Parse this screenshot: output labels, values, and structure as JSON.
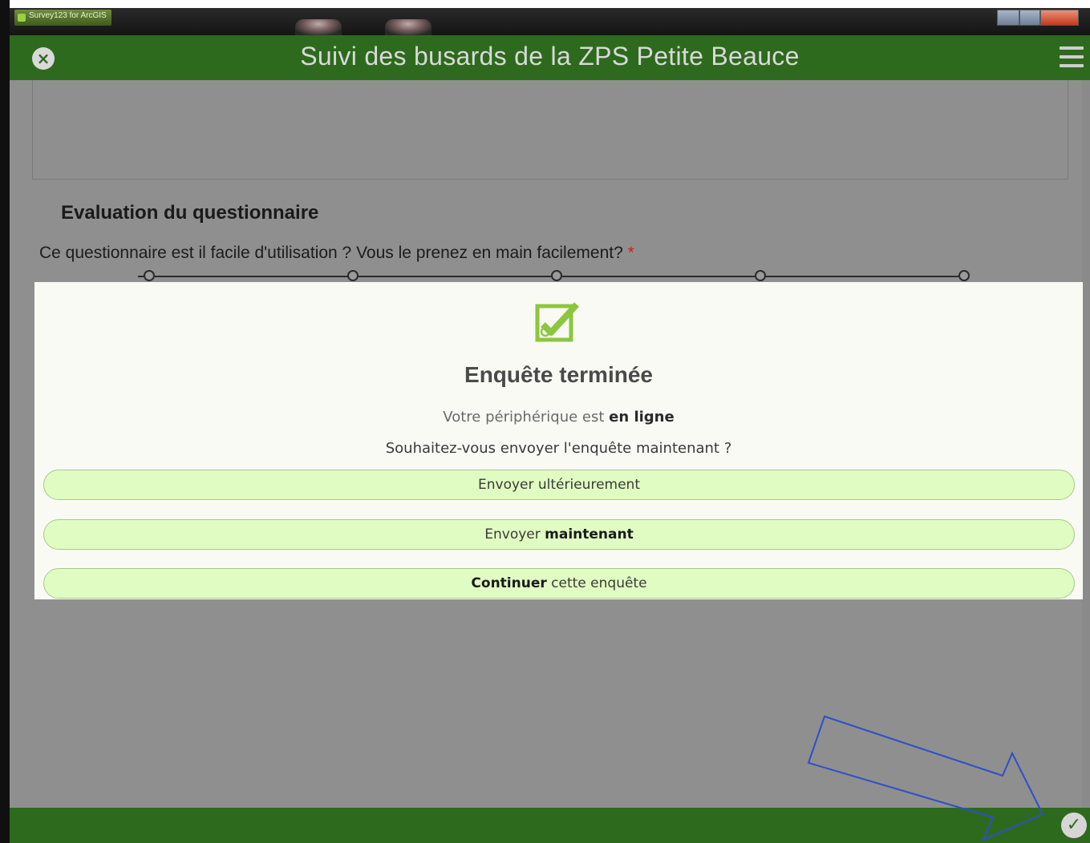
{
  "os": {
    "app_name": "Survey123 for ArcGIS"
  },
  "header": {
    "title": "Suivi des busards de la ZPS Petite Beauce"
  },
  "form": {
    "group_label": "Evaluation du questionnaire",
    "question": "Ce questionnaire est il facile d'utilisation ? Vous le prenez en main facilement?",
    "required_mark": "*"
  },
  "dialog": {
    "title": "Enquête terminée",
    "status_prefix": "Votre périphérique est ",
    "status_value": "en ligne",
    "question": "Souhaitez-vous envoyer l'enquête maintenant ?",
    "btn_later": "Envoyer ultérieurement",
    "btn_now_prefix": "Envoyer ",
    "btn_now_bold": "maintenant",
    "btn_continue_bold": "Continuer",
    "btn_continue_suffix": " cette enquête"
  },
  "icons": {
    "close": "close-circle-icon",
    "menu": "hamburger-menu-icon",
    "survey_complete": "checked-form-icon",
    "submit": "check-circle-icon",
    "annotation": "arrow-annotation"
  },
  "colors": {
    "header_green": "#2e6a1e",
    "button_green": "#e0fcc2",
    "icon_green": "#8cc63f",
    "annotation_blue": "#2f4ec9"
  }
}
